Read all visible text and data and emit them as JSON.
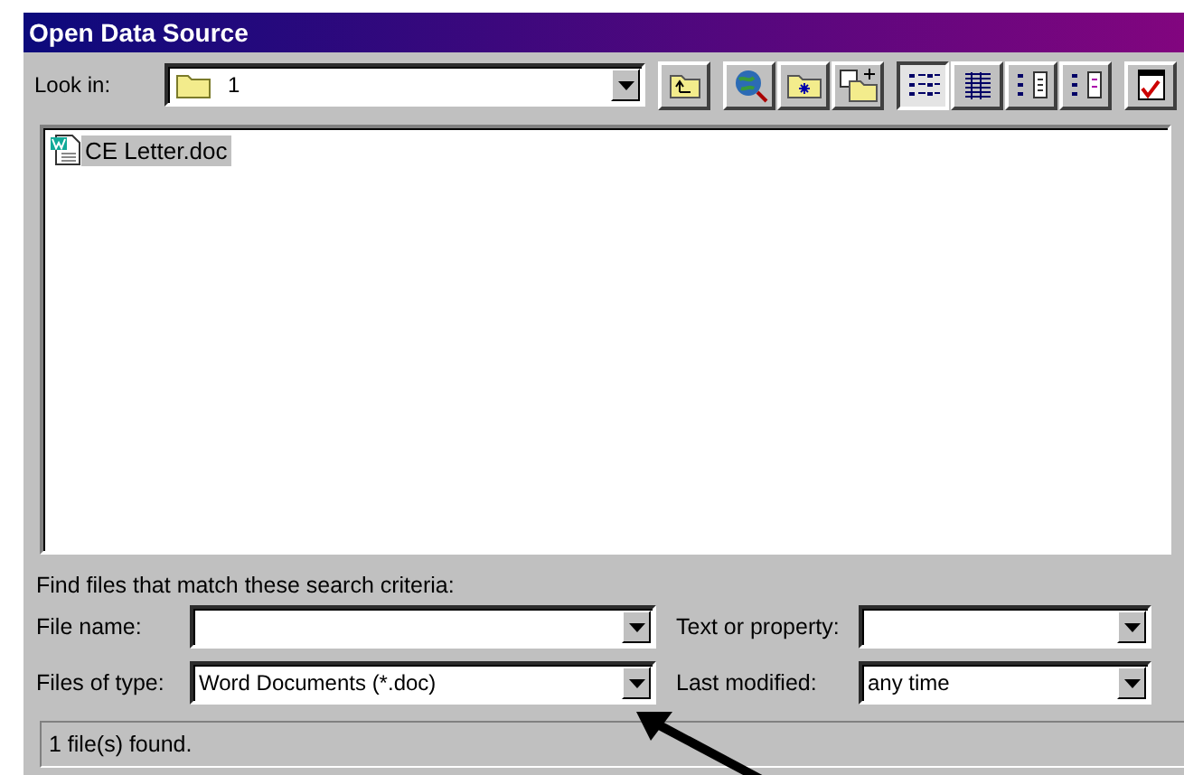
{
  "window": {
    "title": "Open Data Source"
  },
  "look_in": {
    "label": "Look in:",
    "value": "1"
  },
  "toolbar": [
    {
      "kind": "up"
    },
    {
      "kind": "web"
    },
    {
      "kind": "newfolder"
    },
    {
      "kind": "favorites"
    },
    {
      "kind": "list",
      "selected": true
    },
    {
      "kind": "details",
      "selected": false
    },
    {
      "kind": "properties",
      "selected": false
    },
    {
      "kind": "preview",
      "selected": false
    },
    {
      "kind": "tools"
    }
  ],
  "files": [
    {
      "name": "CE Letter.doc",
      "selected": true
    }
  ],
  "criteria": {
    "heading": "Find files that match these search criteria:",
    "fields": [
      {
        "label": "File name:"
      },
      {
        "label": "Text or property:"
      },
      {
        "label": "Files of type:",
        "value": "Word Documents (*.doc)"
      },
      {
        "label": "Last modified:",
        "value": "any time"
      }
    ]
  },
  "status_bar": "1 file(s) found.",
  "annotation": {
    "kind": "arrow"
  }
}
